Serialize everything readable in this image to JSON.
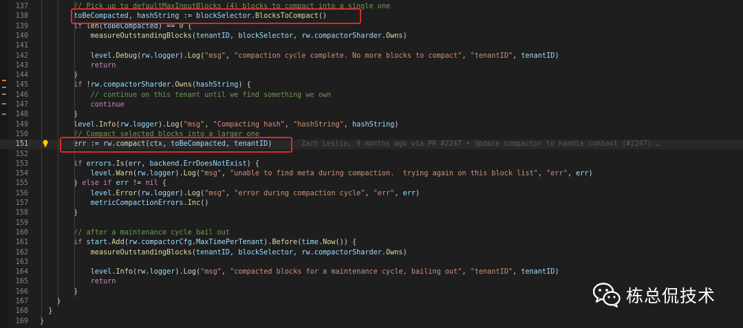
{
  "editor": {
    "lines": [
      {
        "no": "137",
        "tokens": [
          {
            "t": "        "
          },
          {
            "t": "// Pick up to defaultMaxInputBlocks (4) blocks to compact into a single one",
            "c": "cm"
          }
        ]
      },
      {
        "no": "138",
        "tokens": [
          {
            "t": "        "
          },
          {
            "t": "toBeCompacted",
            "c": "var"
          },
          {
            "t": ", ",
            "c": "op"
          },
          {
            "t": "hashString",
            "c": "var"
          },
          {
            "t": " := ",
            "c": "op"
          },
          {
            "t": "blockSelector",
            "c": "var"
          },
          {
            "t": ".",
            "c": "op"
          },
          {
            "t": "BlocksToCompact",
            "c": "fn"
          },
          {
            "t": "()",
            "c": "op"
          }
        ]
      },
      {
        "no": "139",
        "tokens": [
          {
            "t": "        "
          },
          {
            "t": "if ",
            "c": "kw"
          },
          {
            "t": "len",
            "c": "fn"
          },
          {
            "t": "(",
            "c": "op"
          },
          {
            "t": "toBeCompacted",
            "c": "var"
          },
          {
            "t": ") == ",
            "c": "op"
          },
          {
            "t": "0",
            "c": "num"
          },
          {
            "t": " {",
            "c": "op"
          }
        ]
      },
      {
        "no": "140",
        "tokens": [
          {
            "t": "            "
          },
          {
            "t": "measureOutstandingBlocks",
            "c": "fn"
          },
          {
            "t": "(",
            "c": "op"
          },
          {
            "t": "tenantID",
            "c": "var"
          },
          {
            "t": ", ",
            "c": "op"
          },
          {
            "t": "blockSelector",
            "c": "var"
          },
          {
            "t": ", ",
            "c": "op"
          },
          {
            "t": "rw",
            "c": "var"
          },
          {
            "t": ".",
            "c": "op"
          },
          {
            "t": "compactorSharder",
            "c": "var"
          },
          {
            "t": ".",
            "c": "op"
          },
          {
            "t": "Owns",
            "c": "fn"
          },
          {
            "t": ")",
            "c": "op"
          }
        ]
      },
      {
        "no": "141",
        "tokens": []
      },
      {
        "no": "142",
        "tokens": [
          {
            "t": "            "
          },
          {
            "t": "level",
            "c": "var"
          },
          {
            "t": ".",
            "c": "op"
          },
          {
            "t": "Debug",
            "c": "fn"
          },
          {
            "t": "(",
            "c": "op"
          },
          {
            "t": "rw",
            "c": "var"
          },
          {
            "t": ".",
            "c": "op"
          },
          {
            "t": "logger",
            "c": "var"
          },
          {
            "t": ").",
            "c": "op"
          },
          {
            "t": "Log",
            "c": "fn"
          },
          {
            "t": "(",
            "c": "op"
          },
          {
            "t": "\"msg\"",
            "c": "str"
          },
          {
            "t": ", ",
            "c": "op"
          },
          {
            "t": "\"compaction cycle complete. No more blocks to compact\"",
            "c": "str"
          },
          {
            "t": ", ",
            "c": "op"
          },
          {
            "t": "\"tenantID\"",
            "c": "str"
          },
          {
            "t": ", ",
            "c": "op"
          },
          {
            "t": "tenantID",
            "c": "var"
          },
          {
            "t": ")",
            "c": "op"
          }
        ]
      },
      {
        "no": "143",
        "tokens": [
          {
            "t": "            "
          },
          {
            "t": "return",
            "c": "kw"
          }
        ]
      },
      {
        "no": "144",
        "tokens": [
          {
            "t": "        "
          },
          {
            "t": "}",
            "c": "op"
          }
        ]
      },
      {
        "no": "145",
        "tokens": [
          {
            "t": "        "
          },
          {
            "t": "if ",
            "c": "kw"
          },
          {
            "t": "!",
            "c": "op"
          },
          {
            "t": "rw",
            "c": "var"
          },
          {
            "t": ".",
            "c": "op"
          },
          {
            "t": "compactorSharder",
            "c": "var"
          },
          {
            "t": ".",
            "c": "op"
          },
          {
            "t": "Owns",
            "c": "fn"
          },
          {
            "t": "(",
            "c": "op"
          },
          {
            "t": "hashString",
            "c": "var"
          },
          {
            "t": ") {",
            "c": "op"
          }
        ]
      },
      {
        "no": "146",
        "tokens": [
          {
            "t": "            "
          },
          {
            "t": "// continue on this tenant until we find something we own",
            "c": "cm"
          }
        ]
      },
      {
        "no": "147",
        "tokens": [
          {
            "t": "            "
          },
          {
            "t": "continue",
            "c": "kw"
          }
        ]
      },
      {
        "no": "148",
        "tokens": [
          {
            "t": "        "
          },
          {
            "t": "}",
            "c": "op"
          }
        ]
      },
      {
        "no": "149",
        "tokens": [
          {
            "t": "        "
          },
          {
            "t": "level",
            "c": "var"
          },
          {
            "t": ".",
            "c": "op"
          },
          {
            "t": "Info",
            "c": "fn"
          },
          {
            "t": "(",
            "c": "op"
          },
          {
            "t": "rw",
            "c": "var"
          },
          {
            "t": ".",
            "c": "op"
          },
          {
            "t": "logger",
            "c": "var"
          },
          {
            "t": ").",
            "c": "op"
          },
          {
            "t": "Log",
            "c": "fn"
          },
          {
            "t": "(",
            "c": "op"
          },
          {
            "t": "\"msg\"",
            "c": "str"
          },
          {
            "t": ", ",
            "c": "op"
          },
          {
            "t": "\"Compacting hash\"",
            "c": "str"
          },
          {
            "t": ", ",
            "c": "op"
          },
          {
            "t": "\"hashString\"",
            "c": "str"
          },
          {
            "t": ", ",
            "c": "op"
          },
          {
            "t": "hashString",
            "c": "var"
          },
          {
            "t": ")",
            "c": "op"
          }
        ]
      },
      {
        "no": "150",
        "tokens": [
          {
            "t": "        "
          },
          {
            "t": "// Compact selected blocks into a larger one",
            "c": "cm"
          }
        ]
      },
      {
        "no": "151",
        "current": true,
        "tokens": [
          {
            "t": "        "
          },
          {
            "t": "err",
            "c": "var"
          },
          {
            "t": " := ",
            "c": "op"
          },
          {
            "t": "rw",
            "c": "var"
          },
          {
            "t": ".",
            "c": "op"
          },
          {
            "t": "compact",
            "c": "fn"
          },
          {
            "t": "(",
            "c": "op"
          },
          {
            "t": "ctx",
            "c": "var"
          },
          {
            "t": ", ",
            "c": "op"
          },
          {
            "t": "toBeCompacted",
            "c": "var"
          },
          {
            "t": ", ",
            "c": "op"
          },
          {
            "t": "tenantID",
            "c": "var"
          },
          {
            "t": ")",
            "c": "op"
          }
        ]
      },
      {
        "no": "152",
        "tokens": []
      },
      {
        "no": "153",
        "tokens": [
          {
            "t": "        "
          },
          {
            "t": "if ",
            "c": "kw"
          },
          {
            "t": "errors",
            "c": "var"
          },
          {
            "t": ".",
            "c": "op"
          },
          {
            "t": "Is",
            "c": "fn"
          },
          {
            "t": "(",
            "c": "op"
          },
          {
            "t": "err",
            "c": "var"
          },
          {
            "t": ", ",
            "c": "op"
          },
          {
            "t": "backend",
            "c": "var"
          },
          {
            "t": ".",
            "c": "op"
          },
          {
            "t": "ErrDoesNotExist",
            "c": "var"
          },
          {
            "t": ") {",
            "c": "op"
          }
        ]
      },
      {
        "no": "154",
        "tokens": [
          {
            "t": "            "
          },
          {
            "t": "level",
            "c": "var"
          },
          {
            "t": ".",
            "c": "op"
          },
          {
            "t": "Warn",
            "c": "fn"
          },
          {
            "t": "(",
            "c": "op"
          },
          {
            "t": "rw",
            "c": "var"
          },
          {
            "t": ".",
            "c": "op"
          },
          {
            "t": "logger",
            "c": "var"
          },
          {
            "t": ").",
            "c": "op"
          },
          {
            "t": "Log",
            "c": "fn"
          },
          {
            "t": "(",
            "c": "op"
          },
          {
            "t": "\"msg\"",
            "c": "str"
          },
          {
            "t": ", ",
            "c": "op"
          },
          {
            "t": "\"unable to find meta during compaction.  trying again on this block list\"",
            "c": "str"
          },
          {
            "t": ", ",
            "c": "op"
          },
          {
            "t": "\"err\"",
            "c": "str"
          },
          {
            "t": ", ",
            "c": "op"
          },
          {
            "t": "err",
            "c": "var"
          },
          {
            "t": ")",
            "c": "op"
          }
        ]
      },
      {
        "no": "155",
        "tokens": [
          {
            "t": "        "
          },
          {
            "t": "} ",
            "c": "op"
          },
          {
            "t": "else if ",
            "c": "kw"
          },
          {
            "t": "err",
            "c": "var"
          },
          {
            "t": " != ",
            "c": "op"
          },
          {
            "t": "nil",
            "c": "kw"
          },
          {
            "t": " {",
            "c": "op"
          }
        ]
      },
      {
        "no": "156",
        "tokens": [
          {
            "t": "            "
          },
          {
            "t": "level",
            "c": "var"
          },
          {
            "t": ".",
            "c": "op"
          },
          {
            "t": "Error",
            "c": "fn"
          },
          {
            "t": "(",
            "c": "op"
          },
          {
            "t": "rw",
            "c": "var"
          },
          {
            "t": ".",
            "c": "op"
          },
          {
            "t": "logger",
            "c": "var"
          },
          {
            "t": ").",
            "c": "op"
          },
          {
            "t": "Log",
            "c": "fn"
          },
          {
            "t": "(",
            "c": "op"
          },
          {
            "t": "\"msg\"",
            "c": "str"
          },
          {
            "t": ", ",
            "c": "op"
          },
          {
            "t": "\"error during compaction cycle\"",
            "c": "str"
          },
          {
            "t": ", ",
            "c": "op"
          },
          {
            "t": "\"err\"",
            "c": "str"
          },
          {
            "t": ", ",
            "c": "op"
          },
          {
            "t": "err",
            "c": "var"
          },
          {
            "t": ")",
            "c": "op"
          }
        ]
      },
      {
        "no": "157",
        "tokens": [
          {
            "t": "            "
          },
          {
            "t": "metricCompactionErrors",
            "c": "var"
          },
          {
            "t": ".",
            "c": "op"
          },
          {
            "t": "Inc",
            "c": "fn"
          },
          {
            "t": "()",
            "c": "op"
          }
        ]
      },
      {
        "no": "158",
        "tokens": [
          {
            "t": "        "
          },
          {
            "t": "}",
            "c": "op"
          }
        ]
      },
      {
        "no": "159",
        "tokens": []
      },
      {
        "no": "160",
        "tokens": [
          {
            "t": "        "
          },
          {
            "t": "// after a maintenance cycle bail out",
            "c": "cm"
          }
        ]
      },
      {
        "no": "161",
        "tokens": [
          {
            "t": "        "
          },
          {
            "t": "if ",
            "c": "kw"
          },
          {
            "t": "start",
            "c": "var"
          },
          {
            "t": ".",
            "c": "op"
          },
          {
            "t": "Add",
            "c": "fn"
          },
          {
            "t": "(",
            "c": "op"
          },
          {
            "t": "rw",
            "c": "var"
          },
          {
            "t": ".",
            "c": "op"
          },
          {
            "t": "compactorCfg",
            "c": "var"
          },
          {
            "t": ".",
            "c": "op"
          },
          {
            "t": "MaxTimePerTenant",
            "c": "var"
          },
          {
            "t": ").",
            "c": "op"
          },
          {
            "t": "Before",
            "c": "fn"
          },
          {
            "t": "(",
            "c": "op"
          },
          {
            "t": "time",
            "c": "var"
          },
          {
            "t": ".",
            "c": "op"
          },
          {
            "t": "Now",
            "c": "fn"
          },
          {
            "t": "()) {",
            "c": "op"
          }
        ]
      },
      {
        "no": "162",
        "tokens": [
          {
            "t": "            "
          },
          {
            "t": "measureOutstandingBlocks",
            "c": "fn"
          },
          {
            "t": "(",
            "c": "op"
          },
          {
            "t": "tenantID",
            "c": "var"
          },
          {
            "t": ", ",
            "c": "op"
          },
          {
            "t": "blockSelector",
            "c": "var"
          },
          {
            "t": ", ",
            "c": "op"
          },
          {
            "t": "rw",
            "c": "var"
          },
          {
            "t": ".",
            "c": "op"
          },
          {
            "t": "compactorSharder",
            "c": "var"
          },
          {
            "t": ".",
            "c": "op"
          },
          {
            "t": "Owns",
            "c": "fn"
          },
          {
            "t": ")",
            "c": "op"
          }
        ]
      },
      {
        "no": "163",
        "tokens": []
      },
      {
        "no": "164",
        "tokens": [
          {
            "t": "            "
          },
          {
            "t": "level",
            "c": "var"
          },
          {
            "t": ".",
            "c": "op"
          },
          {
            "t": "Info",
            "c": "fn"
          },
          {
            "t": "(",
            "c": "op"
          },
          {
            "t": "rw",
            "c": "var"
          },
          {
            "t": ".",
            "c": "op"
          },
          {
            "t": "logger",
            "c": "var"
          },
          {
            "t": ").",
            "c": "op"
          },
          {
            "t": "Log",
            "c": "fn"
          },
          {
            "t": "(",
            "c": "op"
          },
          {
            "t": "\"msg\"",
            "c": "str"
          },
          {
            "t": ", ",
            "c": "op"
          },
          {
            "t": "\"compacted blocks for a maintenance cycle, bailing out\"",
            "c": "str"
          },
          {
            "t": ", ",
            "c": "op"
          },
          {
            "t": "\"tenantID\"",
            "c": "str"
          },
          {
            "t": ", ",
            "c": "op"
          },
          {
            "t": "tenantID",
            "c": "var"
          },
          {
            "t": ")",
            "c": "op"
          }
        ]
      },
      {
        "no": "165",
        "tokens": [
          {
            "t": "            "
          },
          {
            "t": "return",
            "c": "kw"
          }
        ]
      },
      {
        "no": "166",
        "tokens": [
          {
            "t": "        "
          },
          {
            "t": "}",
            "c": "op"
          }
        ]
      },
      {
        "no": "167",
        "tokens": [
          {
            "t": "    "
          },
          {
            "t": "}",
            "c": "op"
          }
        ]
      },
      {
        "no": "168",
        "tokens": [
          {
            "t": "  "
          },
          {
            "t": "}",
            "c": "op"
          }
        ]
      },
      {
        "no": "169",
        "tokens": [
          {
            "t": "}",
            "c": "op"
          }
        ]
      }
    ],
    "blame_text": "Zach Leslie, 9 months ago via PR #2247 • Update compactor to handle context (#2247) …"
  },
  "highlight_color": "#e02a2a",
  "watermark": {
    "icon": "wechat-icon",
    "text": "栋总侃技术"
  }
}
